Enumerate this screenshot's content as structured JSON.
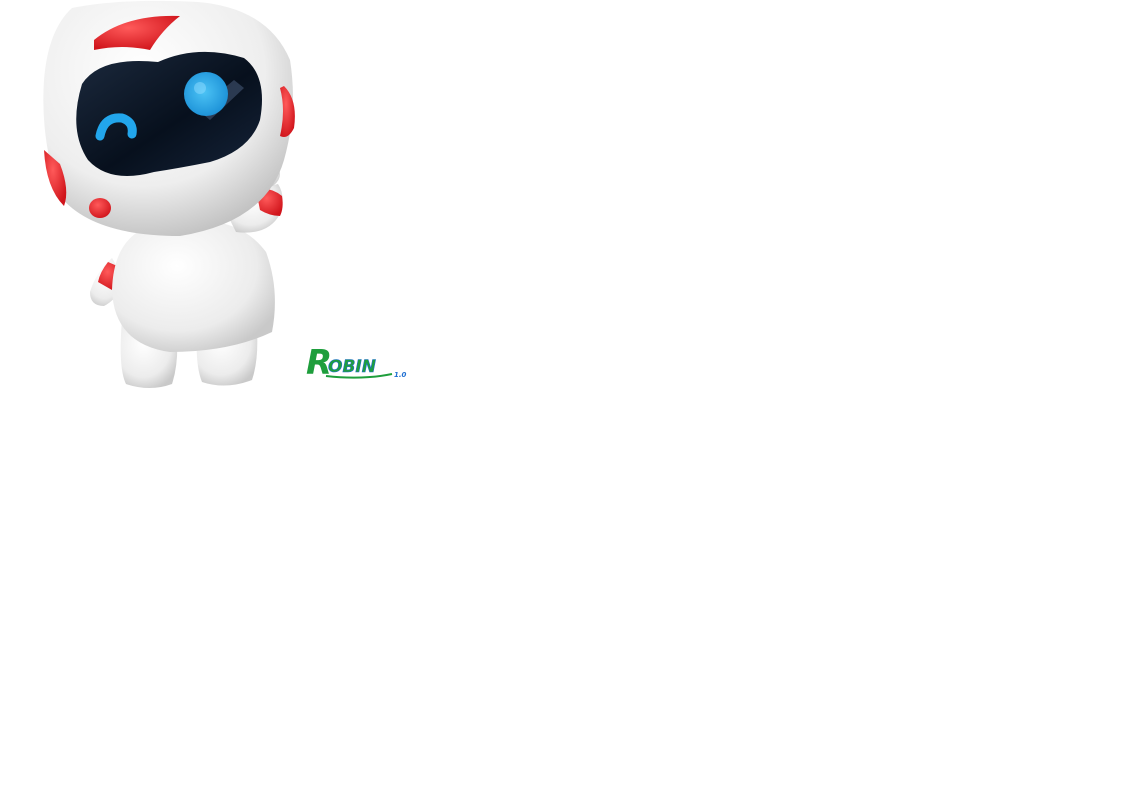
{
  "logo": {
    "initial": "R",
    "rest": "OBIN",
    "version": "1.0"
  },
  "colors": {
    "background": "#ffffff",
    "robot_body": "#f2f2f2",
    "robot_accent": "#e8232a",
    "visor": "#0d1526",
    "eye": "#1fa3e8",
    "logo_green": "#1e9e3c",
    "logo_blue": "#1f6fd1"
  },
  "icons": {
    "mascot": "robot-mascot",
    "logo": "robin-logo"
  }
}
